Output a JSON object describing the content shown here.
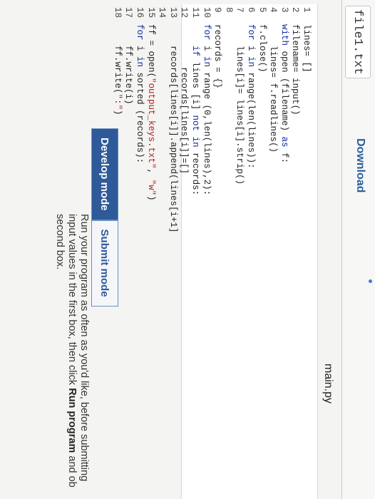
{
  "tabs": {
    "file": "file1.txt",
    "download": "Download"
  },
  "colors": {
    "accent": "#2f5a9a",
    "link": "#2a5d9c",
    "keyword": "#0d2a9e",
    "string": "#b0201c"
  },
  "editor": {
    "title": "main.py",
    "lines": [
      {
        "n": "1",
        "code": "lines= []"
      },
      {
        "n": "2",
        "code": "filename= input()"
      },
      {
        "n": "3",
        "code": "with open (filename) as f:"
      },
      {
        "n": "4",
        "code": "    lines= f.readlines()"
      },
      {
        "n": "5",
        "code": "f.close()"
      },
      {
        "n": "6",
        "code": "for i in range(len(lines)):"
      },
      {
        "n": "7",
        "code": "    lines[i]= lines[i].strip()"
      },
      {
        "n": "8",
        "code": ""
      },
      {
        "n": "9",
        "code": "records = {}"
      },
      {
        "n": "10",
        "code": "for i in range (0,len(lines),2):"
      },
      {
        "n": "11",
        "code": "    if lines [i] not in records:"
      },
      {
        "n": "12",
        "code": "        records[lines[i]]=[]"
      },
      {
        "n": "13",
        "code": "    records[lines[i]].append(lines[i+1]"
      },
      {
        "n": "14",
        "code": ""
      },
      {
        "n": "15",
        "code": "ff = open(\"output_keys.txt\", \"w\")"
      },
      {
        "n": "16",
        "code": "for i in sorted (records):"
      },
      {
        "n": "17",
        "code": "    ff.write(i)"
      },
      {
        "n": "18",
        "code": "    ff.write(\":\")"
      }
    ]
  },
  "modes": {
    "develop": "Develop mode",
    "submit": "Submit mode"
  },
  "instructions": {
    "text_start": "Run your program as often as you'd like, before submitting",
    "text_line2": " input values in the first box, then click ",
    "run_label": "Run program",
    "text_end": " and ob",
    "text_line3": " second box."
  }
}
